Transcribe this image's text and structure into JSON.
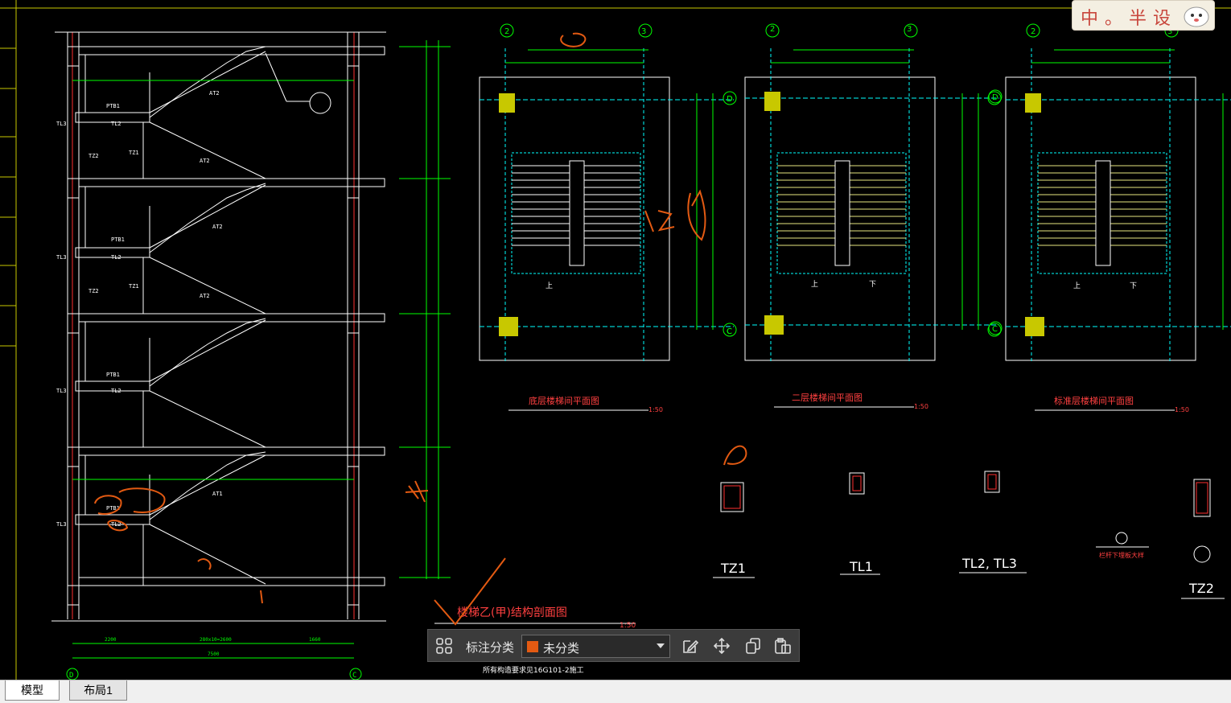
{
  "drawing": {
    "section_title": "楼梯乙(甲)结构剖面图",
    "section_scale": "1:50",
    "plan_titles": [
      "底层楼梯间平面图",
      "二层楼梯间平面图",
      "标准层楼梯间平面图"
    ],
    "plan_scale": "1:50",
    "section_labels": [
      "TZ1",
      "TL1",
      "TL2, TL3",
      "TZ2"
    ],
    "grid_labels": [
      "2",
      "3",
      "2",
      "3",
      "2",
      "3",
      "D",
      "C",
      "D",
      "C",
      "D",
      "C",
      "D",
      "C"
    ],
    "beam_labels": [
      "TL3",
      "TL3",
      "TL3",
      "TL3",
      "TL2",
      "TL2",
      "TL2",
      "TL2",
      "TZ1",
      "TZ1",
      "TZ2",
      "TZ2",
      "PTB1",
      "PTB1",
      "PTB1",
      "PTB1"
    ],
    "stair_labels": [
      "AT2",
      "AT2",
      "AT2",
      "AT2",
      "AT1"
    ],
    "dims_bottom": [
      "2200",
      "280x10=2600",
      "1660",
      "7500"
    ],
    "note_text": "所有构造要求见16G101-2施工",
    "detail_note": "栏杆下埋板大样",
    "up_label": "上",
    "down_label": "下",
    "colors": {
      "background": "#000000",
      "lines": "#ffffff",
      "dims": "#00ff00",
      "grid": "#00ffff",
      "text": "#ff4040",
      "markup": "#e35a12",
      "column": "#c8c800"
    }
  },
  "ime": {
    "chars": [
      "中",
      "。",
      "半",
      "设"
    ]
  },
  "toolbar": {
    "grid_icon": "grid-icon",
    "label": "标注分类",
    "selected": "未分类",
    "icons": [
      "edit-icon",
      "move-icon",
      "copy-icon",
      "paste-icon"
    ]
  },
  "tabs": [
    {
      "label": "模型",
      "active": true
    },
    {
      "label": "布局1",
      "active": false
    }
  ]
}
